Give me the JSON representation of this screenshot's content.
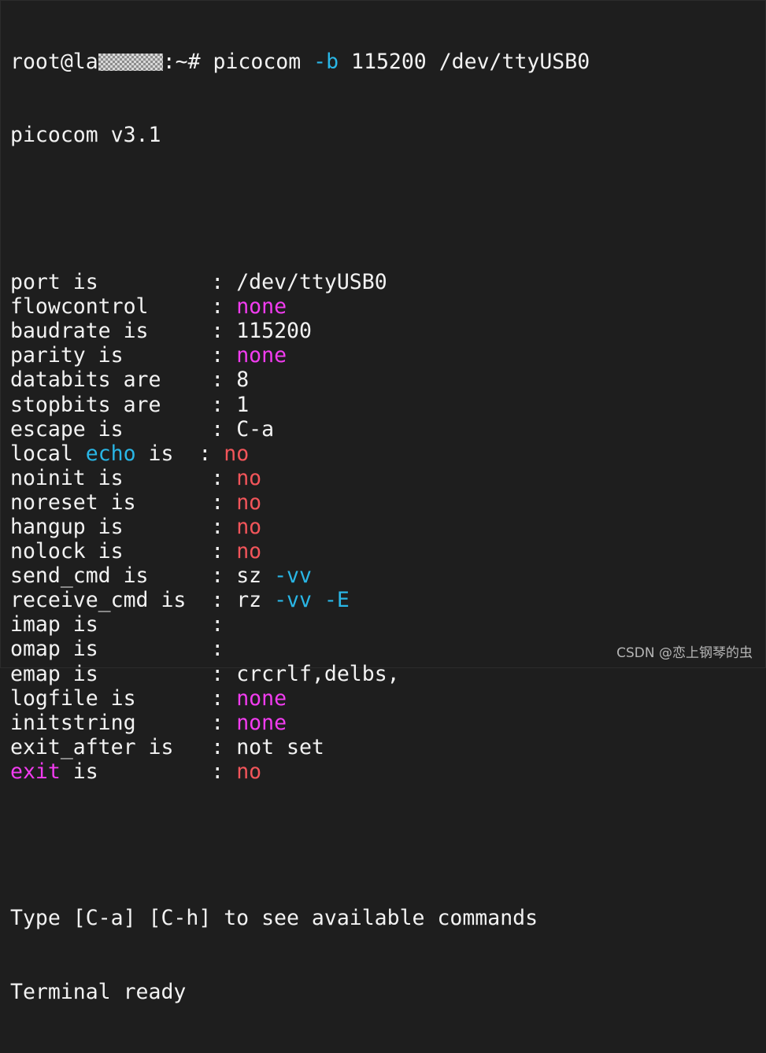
{
  "colors": {
    "background": "#1e1e1e",
    "text": "#f2f2f2",
    "option": "#29b6e6",
    "value_none": "#f23cf0",
    "value_no": "#f2555a"
  },
  "prompt": {
    "user_host_prefix": "root@la",
    "redacted": "hostname-redaction",
    "path_symbol": ":~# ",
    "command": "picocom ",
    "flag": "-b",
    "args": " 115200 /dev/ttyUSB0"
  },
  "version_line": "picocom v3.1",
  "settings": [
    {
      "label": "port is         ",
      "sep": ": ",
      "value": "/dev/ttyUSB0",
      "value_color": "c-white"
    },
    {
      "label": "flowcontrol     ",
      "sep": ": ",
      "value": "none",
      "value_color": "c-magenta"
    },
    {
      "label": "baudrate is     ",
      "sep": ": ",
      "value": "115200",
      "value_color": "c-white"
    },
    {
      "label": "parity is       ",
      "sep": ": ",
      "value": "none",
      "value_color": "c-magenta"
    },
    {
      "label": "databits are    ",
      "sep": ": ",
      "value": "8",
      "value_color": "c-white"
    },
    {
      "label": "stopbits are    ",
      "sep": ": ",
      "value": "1",
      "value_color": "c-white"
    },
    {
      "label": "escape is       ",
      "sep": ": ",
      "value": "C-a",
      "value_color": "c-white"
    },
    {
      "label_parts": [
        "local ",
        "echo",
        " is  "
      ],
      "label_colors": [
        "c-white",
        "c-cyan",
        "c-white"
      ],
      "sep": ": ",
      "value": "no",
      "value_color": "c-red"
    },
    {
      "label": "noinit is       ",
      "sep": ": ",
      "value": "no",
      "value_color": "c-red"
    },
    {
      "label": "noreset is      ",
      "sep": ": ",
      "value": "no",
      "value_color": "c-red"
    },
    {
      "label": "hangup is       ",
      "sep": ": ",
      "value": "no",
      "value_color": "c-red"
    },
    {
      "label": "nolock is       ",
      "sep": ": ",
      "value": "no",
      "value_color": "c-red"
    },
    {
      "label": "send_cmd is     ",
      "sep": ": ",
      "value_parts": [
        "sz ",
        "-vv"
      ],
      "value_colors": [
        "c-white",
        "c-cyan"
      ]
    },
    {
      "label": "receive_cmd is  ",
      "sep": ": ",
      "value_parts": [
        "rz ",
        "-vv",
        " ",
        "-E"
      ],
      "value_colors": [
        "c-white",
        "c-cyan",
        "c-white",
        "c-cyan"
      ]
    },
    {
      "label": "imap is         ",
      "sep": ": ",
      "value": "",
      "value_color": "c-white"
    },
    {
      "label": "omap is         ",
      "sep": ": ",
      "value": "",
      "value_color": "c-white"
    },
    {
      "label": "emap is         ",
      "sep": ": ",
      "value": "crcrlf,delbs,",
      "value_color": "c-white"
    },
    {
      "label": "logfile is      ",
      "sep": ": ",
      "value": "none",
      "value_color": "c-magenta"
    },
    {
      "label": "initstring      ",
      "sep": ": ",
      "value": "none",
      "value_color": "c-magenta"
    },
    {
      "label": "exit_after is   ",
      "sep": ": ",
      "value": "not set",
      "value_color": "c-white"
    },
    {
      "label_parts": [
        "exit",
        " is         "
      ],
      "label_colors": [
        "c-magenta",
        "c-white"
      ],
      "sep": ": ",
      "value": "no",
      "value_color": "c-red"
    }
  ],
  "help_line": "Type [C-a] [C-h] to see available commands",
  "ready_line": "Terminal ready",
  "watermark": "CSDN @恋上钢琴的虫"
}
